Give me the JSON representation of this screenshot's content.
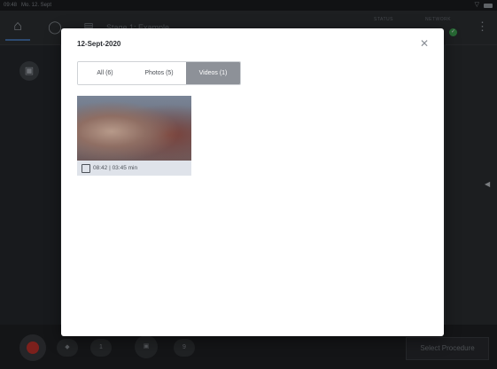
{
  "statusbar": {
    "time": "09:48",
    "date": "Mo. 12. Sept"
  },
  "topbar": {
    "stage_text": "Stage 1: Example",
    "status_label": "STATUS",
    "network_label": "NETWORK"
  },
  "bottombar": {
    "counter_1": "1",
    "counter_2": "9",
    "select_procedure": "Select Procedure"
  },
  "modal": {
    "title": "12-Sept-2020",
    "tabs": [
      {
        "label": "All (6)",
        "active": false
      },
      {
        "label": "Photos (5)",
        "active": false
      },
      {
        "label": "Videos (1)",
        "active": true
      }
    ],
    "media": [
      {
        "type": "video",
        "timestamp": "08:42",
        "duration": "03:45 min",
        "caption": "08:42 | 03:45 min"
      }
    ]
  },
  "colors": {
    "record": "#c9352e",
    "network_ok": "#3faa55",
    "active_tab": "#8d9198",
    "accent": "#4a78b5"
  }
}
